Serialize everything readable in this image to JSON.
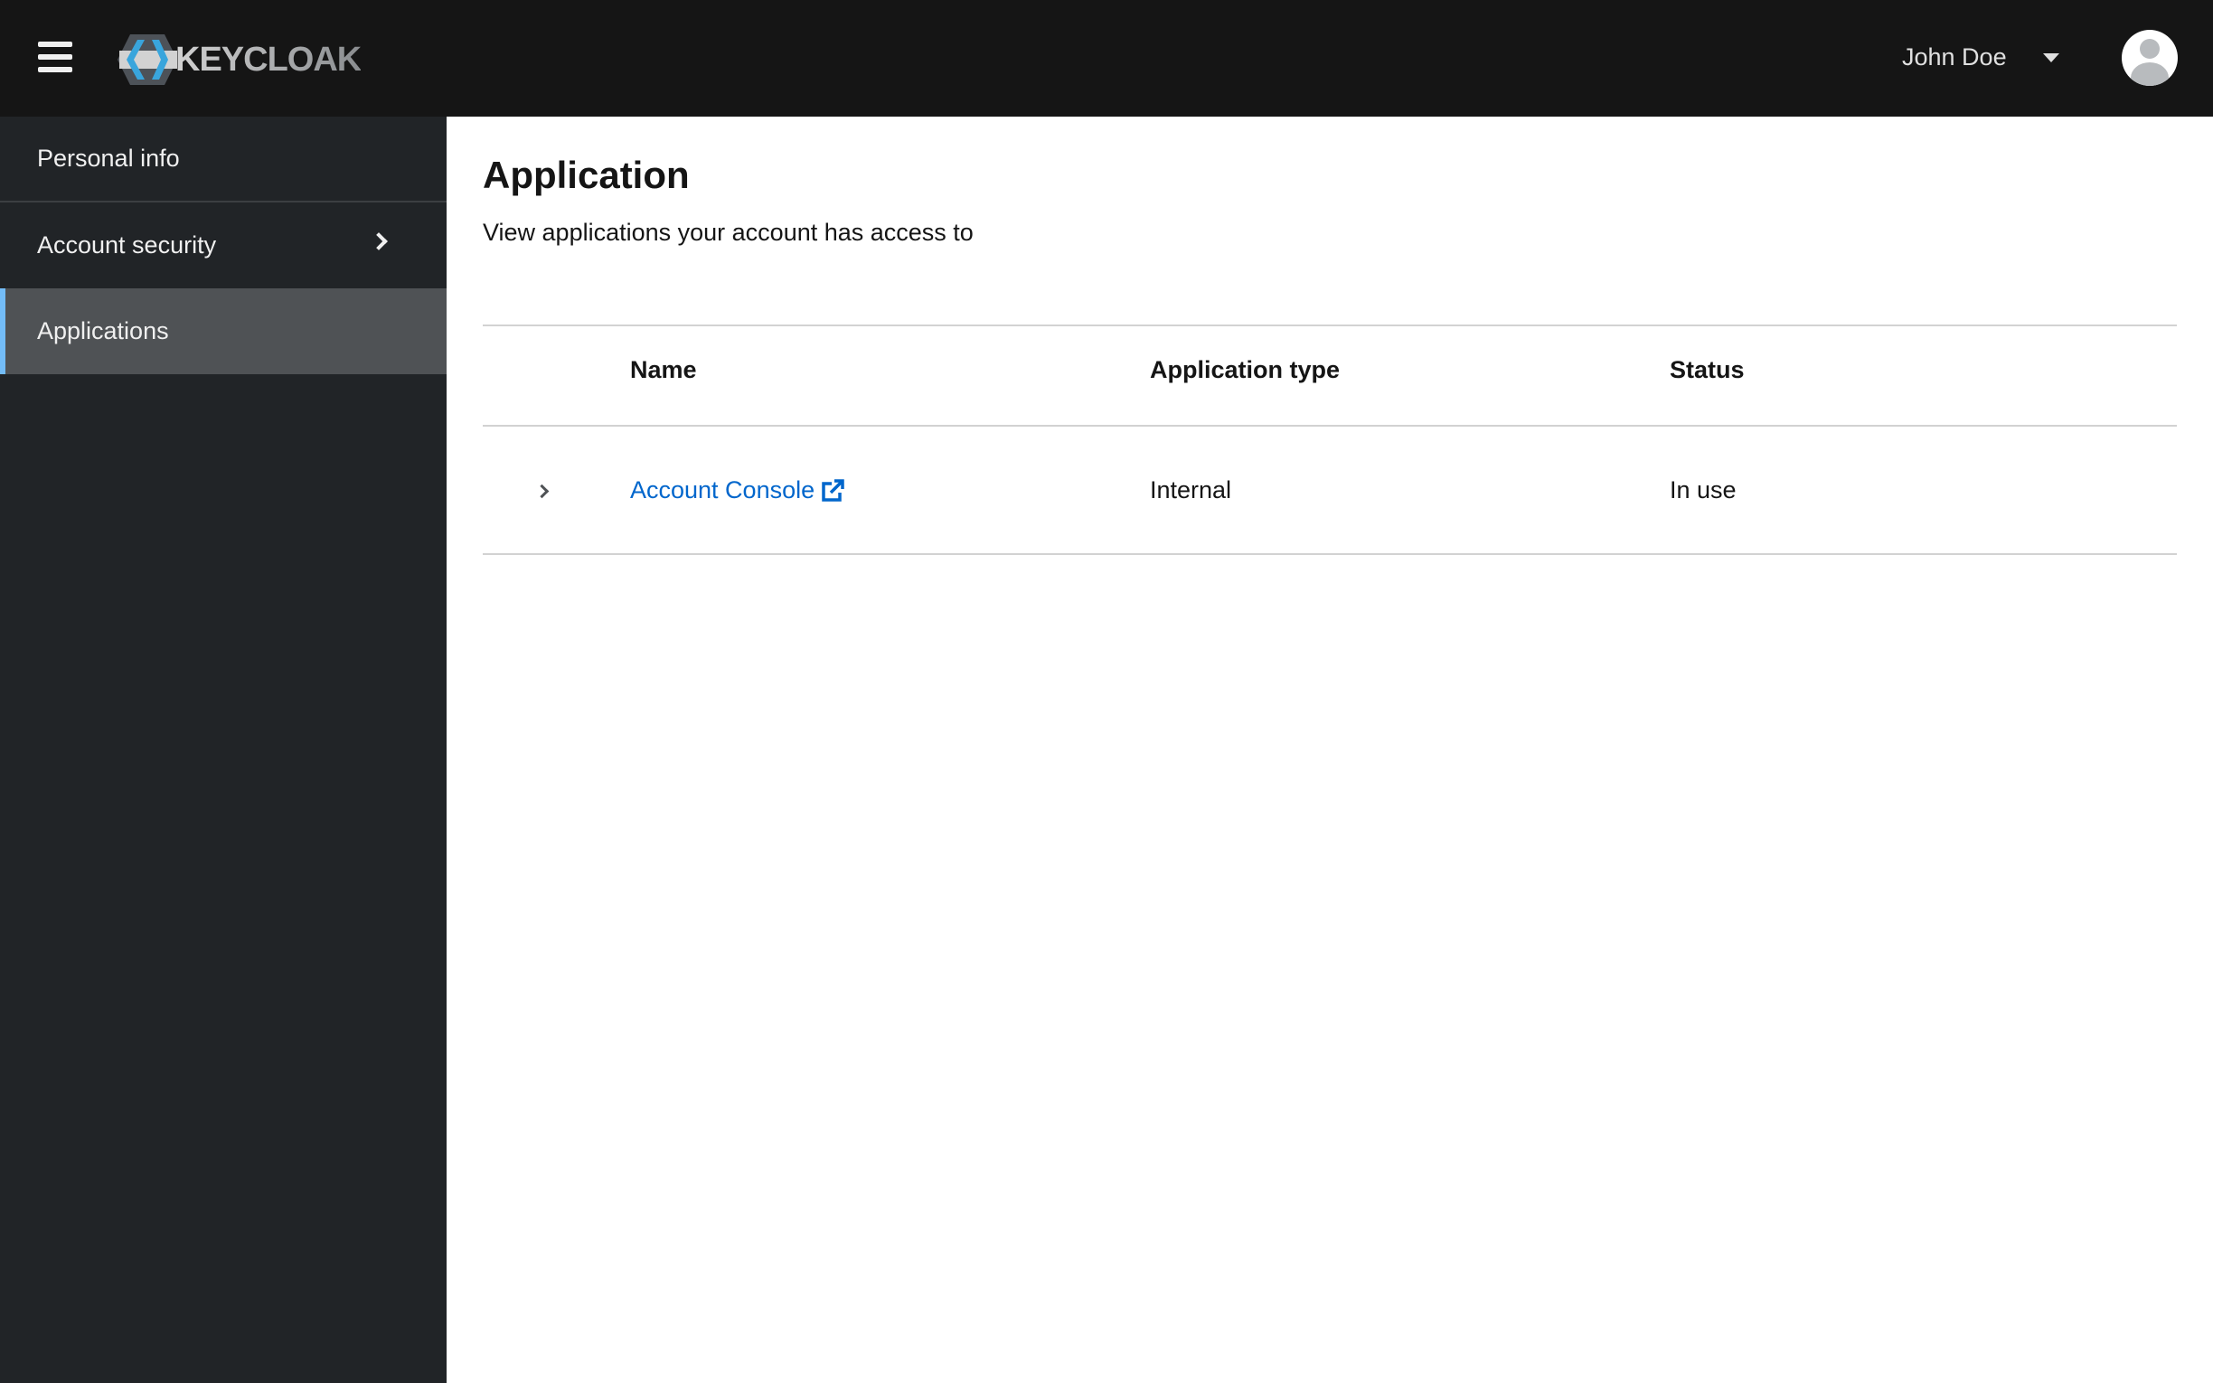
{
  "header": {
    "logo_text": "KEYCLOAK",
    "user_name": "John Doe"
  },
  "sidebar": {
    "items": [
      {
        "label": "Personal info"
      },
      {
        "label": "Account security"
      },
      {
        "label": "Applications"
      }
    ]
  },
  "page": {
    "title": "Application",
    "subtitle": "View applications your account has access to"
  },
  "table": {
    "columns": [
      "Name",
      "Application type",
      "Status"
    ],
    "rows": [
      {
        "name": "Account Console",
        "type": "Internal",
        "status": "In use"
      }
    ]
  },
  "colors": {
    "accent": "#0066cc",
    "active_border": "#73bcf7",
    "header_bg": "#151515",
    "sidebar_bg": "#212427"
  }
}
